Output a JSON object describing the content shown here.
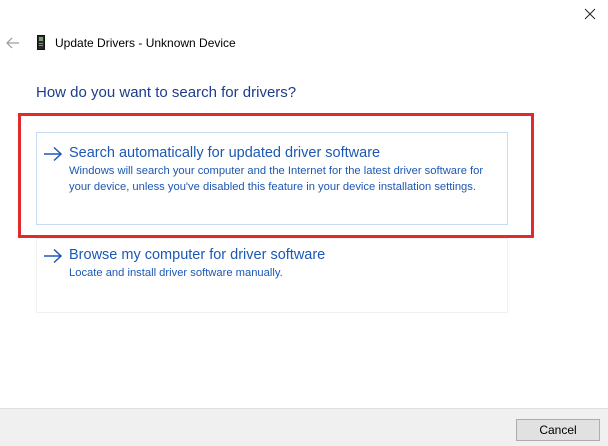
{
  "window": {
    "title": "Update Drivers - Unknown Device",
    "close_icon": "close-icon",
    "back_icon": "back-arrow-icon",
    "device_icon": "device-icon"
  },
  "main": {
    "heading": "How do you want to search for drivers?",
    "options": [
      {
        "title": "Search automatically for updated driver software",
        "description": "Windows will search your computer and the Internet for the latest driver software for your device, unless you've disabled this feature in your device installation settings.",
        "icon": "arrow-right-icon"
      },
      {
        "title": "Browse my computer for driver software",
        "description": "Locate and install driver software manually.",
        "icon": "arrow-right-icon"
      }
    ]
  },
  "footer": {
    "cancel_label": "Cancel"
  },
  "colors": {
    "heading": "#1c3c8c",
    "link": "#1c58b5",
    "highlight": "#e02b2b",
    "footer_bg": "#f0f0f0"
  }
}
